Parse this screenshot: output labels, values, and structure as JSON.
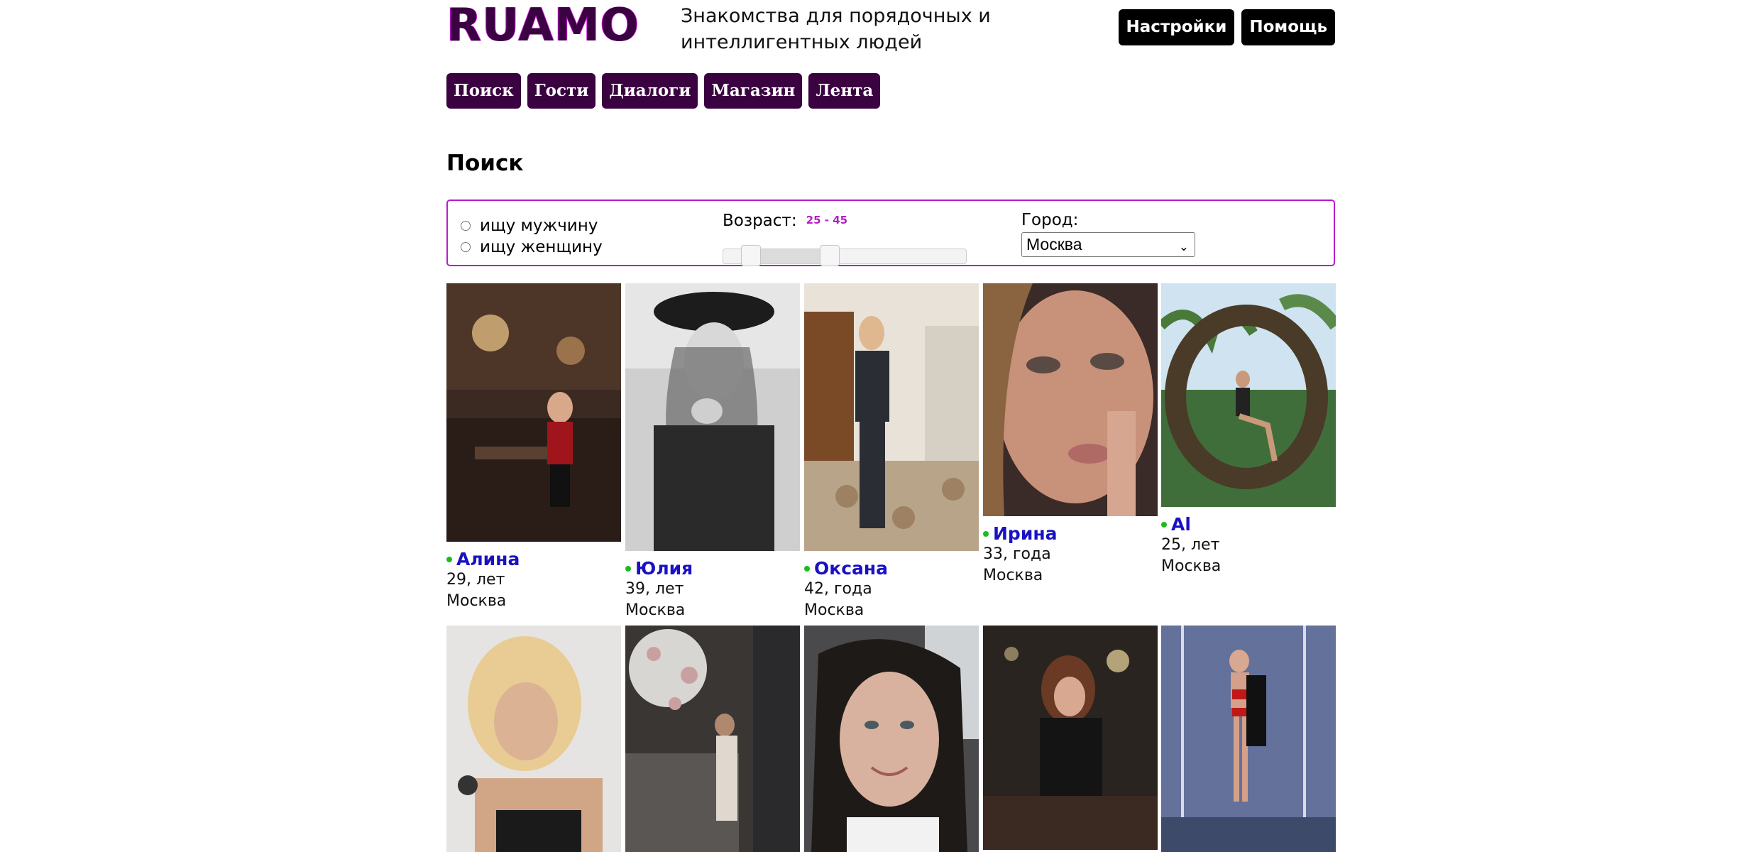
{
  "header": {
    "logo_text": "RUAMO",
    "tagline": "Знакомства для порядочных и интеллигентных людей",
    "buttons": [
      "Настройки",
      "Помощь"
    ]
  },
  "nav": [
    "Поиск",
    "Гости",
    "Диалоги",
    "Магазин",
    "Лента"
  ],
  "page_title": "Поиск",
  "filter": {
    "seek_options": [
      "ищу мужчину",
      "ищу женщину"
    ],
    "age_label": "Возраст:",
    "age_range": "25 - 45",
    "age_min": 25,
    "age_max": 45,
    "city_label": "Город:",
    "city_selected": "Москва"
  },
  "profiles": [
    {
      "name": "Алина",
      "age": "29, лет",
      "city": "Москва",
      "online": true,
      "photo": "restaurant-photo"
    },
    {
      "name": "Юлия",
      "age": "39, лет",
      "city": "Москва",
      "online": true,
      "photo": "bw-hat-photo"
    },
    {
      "name": "Оксана",
      "age": "42, года",
      "city": "Москва",
      "online": true,
      "photo": "mirror-selfie-photo"
    },
    {
      "name": "Ирина",
      "age": "33, года",
      "city": "Москва",
      "online": true,
      "photo": "closeup-face-photo"
    },
    {
      "name": "Al",
      "age": "25, лет",
      "city": "Москва",
      "online": true,
      "photo": "nest-swing-photo"
    },
    {
      "name": "",
      "age": "",
      "city": "",
      "online": false,
      "photo": "blonde-photo"
    },
    {
      "name": "",
      "age": "",
      "city": "",
      "online": false,
      "photo": "flowers-interior-photo"
    },
    {
      "name": "",
      "age": "",
      "city": "",
      "online": false,
      "photo": "car-selfie-photo"
    },
    {
      "name": "",
      "age": "",
      "city": "",
      "online": false,
      "photo": "cafe-night-photo"
    },
    {
      "name": "",
      "age": "",
      "city": "",
      "online": false,
      "photo": "pole-studio-photo"
    }
  ],
  "colors": {
    "brand": "#3a0240",
    "accent": "#b41ec8",
    "name_link": "#1a11c2",
    "online": "#1bbd1b"
  }
}
